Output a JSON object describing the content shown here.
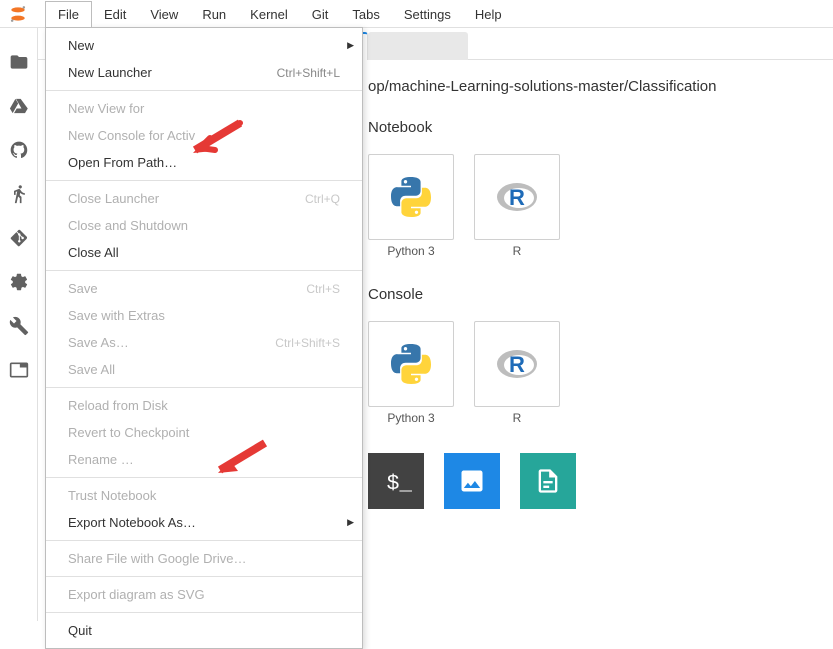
{
  "menubar": {
    "items": [
      "File",
      "Edit",
      "View",
      "Run",
      "Kernel",
      "Git",
      "Tabs",
      "Settings",
      "Help"
    ],
    "open_index": 0
  },
  "file_menu": {
    "groups": [
      [
        {
          "label": "New",
          "has_submenu": true,
          "disabled": false
        },
        {
          "label": "New Launcher",
          "shortcut": "Ctrl+Shift+L",
          "disabled": false
        }
      ],
      [
        {
          "label": "New View for",
          "disabled": true
        },
        {
          "label": "New Console for Activ",
          "disabled": true
        },
        {
          "label": "Open From Path…",
          "disabled": false
        }
      ],
      [
        {
          "label": "Close Launcher",
          "shortcut": "Ctrl+Q",
          "disabled": true
        },
        {
          "label": "Close and Shutdown",
          "disabled": true
        },
        {
          "label": "Close All",
          "disabled": false
        }
      ],
      [
        {
          "label": "Save",
          "shortcut": "Ctrl+S",
          "disabled": true
        },
        {
          "label": "Save with Extras",
          "disabled": true
        },
        {
          "label": "Save As…",
          "shortcut": "Ctrl+Shift+S",
          "disabled": true
        },
        {
          "label": "Save All",
          "disabled": true
        }
      ],
      [
        {
          "label": "Reload from Disk",
          "disabled": true
        },
        {
          "label": "Revert to Checkpoint",
          "disabled": true
        },
        {
          "label": "Rename …",
          "disabled": true
        }
      ],
      [
        {
          "label": "Trust Notebook",
          "disabled": true
        },
        {
          "label": "Export Notebook As…",
          "has_submenu": true,
          "disabled": false
        }
      ],
      [
        {
          "label": "Share File with Google Drive…",
          "disabled": true
        }
      ],
      [
        {
          "label": "Export diagram as SVG",
          "disabled": true
        }
      ],
      [
        {
          "label": "Quit",
          "disabled": false
        }
      ]
    ]
  },
  "breadcrumb": "op/machine-Learning-solutions-master/Classification",
  "sections": [
    {
      "title": "Notebook",
      "cards": [
        {
          "label": "Python 3",
          "icon": "python"
        },
        {
          "label": "R",
          "icon": "r"
        }
      ]
    },
    {
      "title": "Console",
      "cards": [
        {
          "label": "Python 3",
          "icon": "python"
        },
        {
          "label": "R",
          "icon": "r"
        }
      ]
    }
  ],
  "bottom_icons": [
    "terminal",
    "image",
    "file"
  ]
}
